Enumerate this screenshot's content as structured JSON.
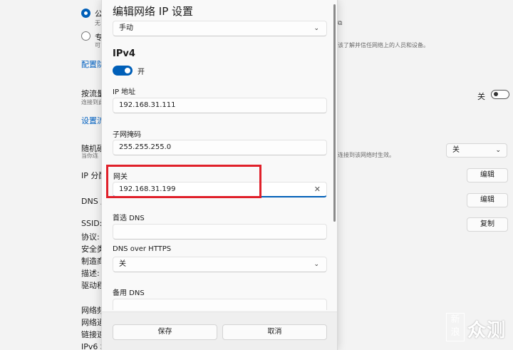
{
  "background": {
    "network_profile": {
      "option1_label": "公",
      "option1_sub": "无",
      "option2_label": "专",
      "option2_sub": "可",
      "option2_right_desc": "该了解并信任网络上的人员和设备。",
      "config_link": "配置防"
    },
    "metered": {
      "label": "按流量",
      "sub": "连接到此",
      "toggle_text": "关"
    },
    "set_data_link": "设置流",
    "random": {
      "label": "随机硬",
      "sub": "当你连",
      "right_desc": "连接到该网络时生效。",
      "select_value": "关"
    },
    "ip_assign": {
      "label": "IP 分配",
      "button": "编辑"
    },
    "dns": {
      "label": "DNS 服",
      "button": "编辑"
    },
    "props": [
      "SSID:",
      "协议:",
      "安全类",
      "制造商",
      "描述:",
      "驱动程"
    ],
    "copy_button": "复制",
    "props2": [
      "网络频",
      "网络通",
      "链接速",
      "IPv6 地"
    ]
  },
  "dialog": {
    "title": "编辑网络 IP 设置",
    "mode_select": "手动",
    "ipv4_heading": "IPv4",
    "ipv4_toggle_label": "开",
    "ip_label": "IP 地址",
    "ip_value": "192.168.31.111",
    "mask_label": "子网掩码",
    "mask_value": "255.255.255.0",
    "gateway_label": "网关",
    "gateway_value": "192.168.31.199",
    "dns1_label": "首选 DNS",
    "dns1_value": "",
    "dns_https_label": "DNS over HTTPS",
    "dns_https_value": "关",
    "dns2_label": "备用 DNS",
    "save_button": "保存",
    "cancel_button": "取消"
  },
  "watermark": {
    "box_text": "新浪",
    "text": "众测"
  },
  "colors": {
    "accent": "#005fb8",
    "highlight": "#e0202a"
  }
}
